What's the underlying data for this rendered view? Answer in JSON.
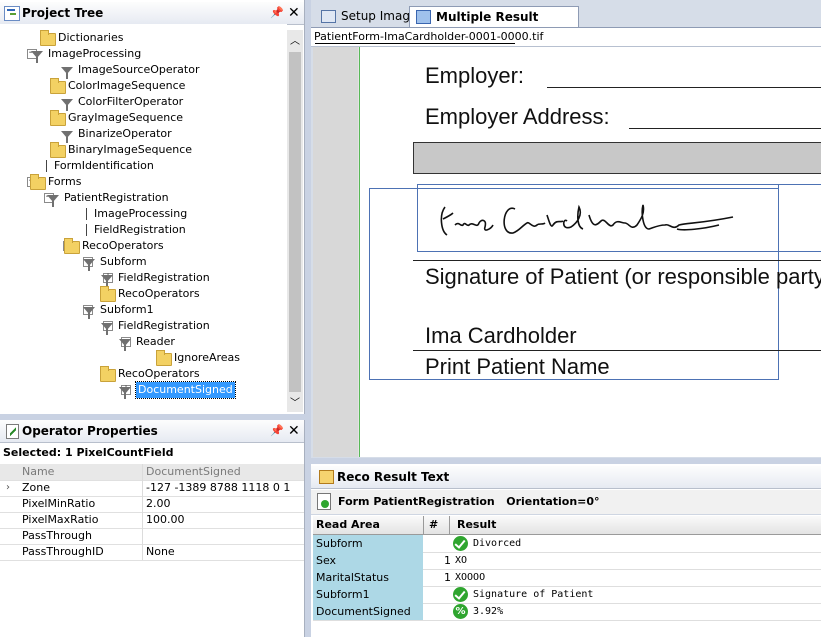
{
  "project_tree": {
    "title": "Project Tree",
    "pin": "ꟷ",
    "close": "✕",
    "nodes": [
      {
        "label": "Dictionaries",
        "icon": "folder",
        "exp": ""
      },
      {
        "label": "ImageProcessing",
        "icon": "funnel",
        "exp": "⊟"
      },
      {
        "label": "ImageSourceOperator",
        "icon": "funnel",
        "exp": ""
      },
      {
        "label": "ColorImageSequence",
        "icon": "folder",
        "exp": ""
      },
      {
        "label": "ColorFilterOperator",
        "icon": "funnel",
        "exp": ""
      },
      {
        "label": "GrayImageSequence",
        "icon": "folder",
        "exp": ""
      },
      {
        "label": "BinarizeOperator",
        "icon": "funnel",
        "exp": ""
      },
      {
        "label": "BinaryImageSequence",
        "icon": "folder",
        "exp": ""
      },
      {
        "label": "FormIdentification",
        "icon": "none",
        "exp": ""
      },
      {
        "label": "Forms",
        "icon": "folder",
        "exp": "⊟"
      },
      {
        "label": "PatientRegistration",
        "icon": "funnel",
        "exp": "⊟"
      },
      {
        "label": "ImageProcessing",
        "icon": "none",
        "exp": ""
      },
      {
        "label": "FieldRegistration",
        "icon": "none",
        "exp": ""
      },
      {
        "label": "RecoOperators",
        "icon": "folder",
        "exp": "⊟"
      },
      {
        "label": "Subform",
        "icon": "funnel",
        "exp": "⊟"
      },
      {
        "label": "FieldRegistration",
        "icon": "funnel",
        "exp": "⊞"
      },
      {
        "label": "RecoOperators",
        "icon": "folder",
        "exp": "⊞"
      },
      {
        "label": "Subform1",
        "icon": "funnel",
        "exp": "⊟"
      },
      {
        "label": "FieldRegistration",
        "icon": "funnel",
        "exp": "⊟"
      },
      {
        "label": "Reader",
        "icon": "funnel",
        "exp": "⊟"
      },
      {
        "label": "IgnoreAreas",
        "icon": "folder",
        "exp": ""
      },
      {
        "label": "RecoOperators",
        "icon": "folder",
        "exp": "⊟"
      },
      {
        "label": "DocumentSigned",
        "icon": "funnel",
        "exp": "⊞"
      }
    ]
  },
  "operator_properties": {
    "title": "Operator Properties",
    "pin": "ꟷ",
    "close": "✕",
    "selected": "Selected:  1 PixelCountField",
    "rows": [
      {
        "key": "Name",
        "value": "DocumentSigned",
        "dim": true
      },
      {
        "key": "Zone",
        "value": "-127 -1389 8788 1118 0 1",
        "dim": false
      },
      {
        "key": "PixelMinRatio",
        "value": "2.00",
        "dim": false
      },
      {
        "key": "PixelMaxRatio",
        "value": "100.00",
        "dim": false
      },
      {
        "key": "PassThrough",
        "value": "",
        "dim": false
      },
      {
        "key": "PassThroughID",
        "value": "None",
        "dim": false
      }
    ]
  },
  "image_tabs": {
    "tab1": "Setup Image",
    "tab2": "Multiple Result Images"
  },
  "file_path": "PatientForm-ImaCardholder-0001-0000.tif",
  "document": {
    "employer": "Employer:",
    "employer_address": "Employer Address:",
    "signature_label": "Signature of Patient (or responsible party",
    "patient_name": "Ima Cardholder",
    "print_name_label": "Print Patient Name"
  },
  "reco_result": {
    "title": "Reco Result Text",
    "form_line": "Form PatientRegistration   Orientation=0°",
    "columns": [
      "Read Area",
      "#",
      "Result"
    ],
    "rows": [
      {
        "area": "Subform",
        "num": "",
        "result": "Divorced",
        "status": "check"
      },
      {
        "area": "Sex",
        "num": "1",
        "result": "XO",
        "status": "none"
      },
      {
        "area": "MaritalStatus",
        "num": "1",
        "result": "XOOOO",
        "status": "none"
      },
      {
        "area": "Subform1",
        "num": "",
        "result": "Signature of Patient",
        "status": "check"
      },
      {
        "area": "DocumentSigned",
        "num": "",
        "result": "3.92%",
        "status": "pct"
      }
    ]
  },
  "colors": {
    "pane_title_bg": "#e9edf5",
    "selection": "#3399ff",
    "result_area_bg": "#add8e6",
    "ok_green": "#2fa52f"
  }
}
